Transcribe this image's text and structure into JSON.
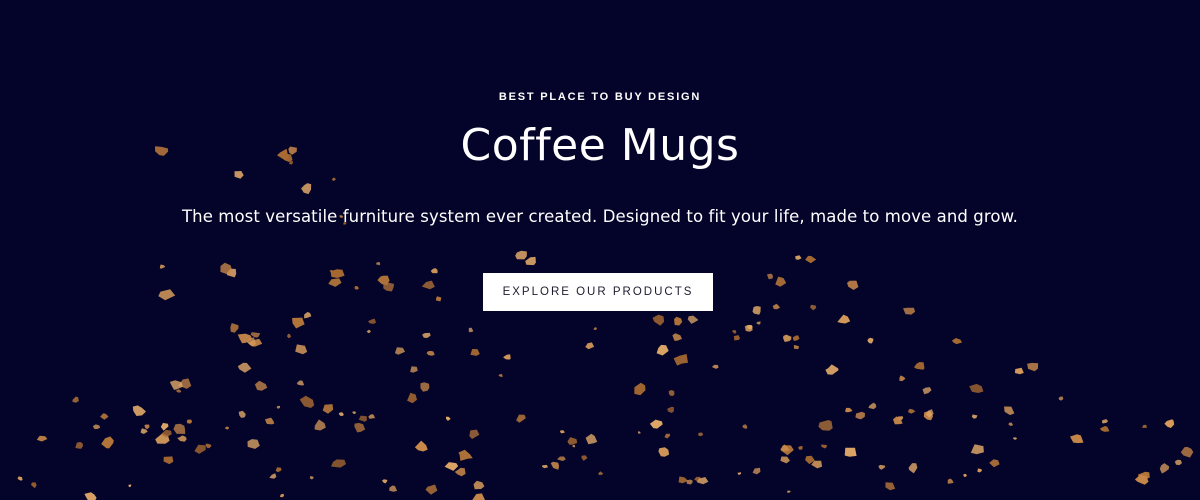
{
  "hero": {
    "eyebrow": "BEST PLACE TO BUY DESIGN",
    "title": "Coffee Mugs",
    "subtitle": "The most versatile furniture system ever created. Designed to fit your life, made to move and grow.",
    "cta_label": "EXPLORE OUR PRODUCTS"
  },
  "colors": {
    "background": "#04042a",
    "text": "#ffffff",
    "button_bg": "#ffffff",
    "button_text": "#1c1c2e",
    "particle": "#c8884a"
  },
  "decor": {
    "background_image": "coffee-grounds-particles"
  }
}
